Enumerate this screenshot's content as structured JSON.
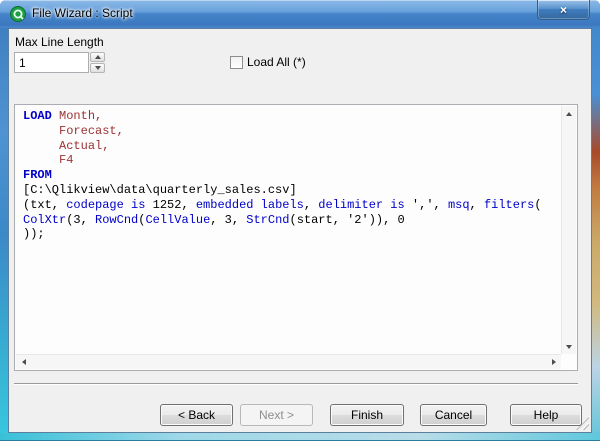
{
  "window": {
    "title": "File Wizard : Script",
    "close_glyph": "×"
  },
  "form": {
    "max_line_length_label": "Max Line Length",
    "max_line_length_value": "1",
    "load_all_label": "Load All (*)"
  },
  "script": {
    "lines": [
      [
        {
          "t": "LOAD",
          "c": "kwb"
        },
        {
          "t": " ",
          "c": "plain"
        },
        {
          "t": "Month,",
          "c": "field"
        }
      ],
      [
        {
          "t": "     ",
          "c": "plain"
        },
        {
          "t": "Forecast,",
          "c": "field"
        }
      ],
      [
        {
          "t": "     ",
          "c": "plain"
        },
        {
          "t": "Actual,",
          "c": "field"
        }
      ],
      [
        {
          "t": "     ",
          "c": "plain"
        },
        {
          "t": "F4",
          "c": "field"
        }
      ],
      [
        {
          "t": "FROM",
          "c": "kwb"
        }
      ],
      [
        {
          "t": "[C:\\Qlikview\\data\\quarterly_sales.csv]",
          "c": "plain"
        }
      ],
      [
        {
          "t": "(txt, ",
          "c": "plain"
        },
        {
          "t": "codepage is",
          "c": "kw"
        },
        {
          "t": " 1252, ",
          "c": "plain"
        },
        {
          "t": "embedded labels",
          "c": "kw"
        },
        {
          "t": ", ",
          "c": "plain"
        },
        {
          "t": "delimiter is",
          "c": "kw"
        },
        {
          "t": " ',', ",
          "c": "plain"
        },
        {
          "t": "msq",
          "c": "kw"
        },
        {
          "t": ", ",
          "c": "plain"
        },
        {
          "t": "filters",
          "c": "kw"
        },
        {
          "t": "(",
          "c": "plain"
        }
      ],
      [
        {
          "t": "ColXtr",
          "c": "kw"
        },
        {
          "t": "(3, ",
          "c": "plain"
        },
        {
          "t": "RowCnd",
          "c": "kw"
        },
        {
          "t": "(",
          "c": "plain"
        },
        {
          "t": "CellValue",
          "c": "kw"
        },
        {
          "t": ", 3, ",
          "c": "plain"
        },
        {
          "t": "StrCnd",
          "c": "kw"
        },
        {
          "t": "(start, '2')), 0",
          "c": "plain"
        }
      ],
      [
        {
          "t": "));",
          "c": "plain"
        }
      ]
    ]
  },
  "buttons": [
    {
      "label": "< Back",
      "enabled": true
    },
    {
      "label": "Next >",
      "enabled": false
    },
    {
      "label": "Finish",
      "enabled": true
    },
    {
      "label": "Cancel",
      "enabled": true
    },
    {
      "label": "Help",
      "enabled": true
    }
  ],
  "colors": {
    "titlebar_blue": "#3d7ec7",
    "client_bg": "#f0f0f0",
    "script_bg": "#fdfdfd",
    "keyword_blue": "#0000c8",
    "field_red": "#9c3232",
    "qlikview_green": "#1e9e46"
  }
}
